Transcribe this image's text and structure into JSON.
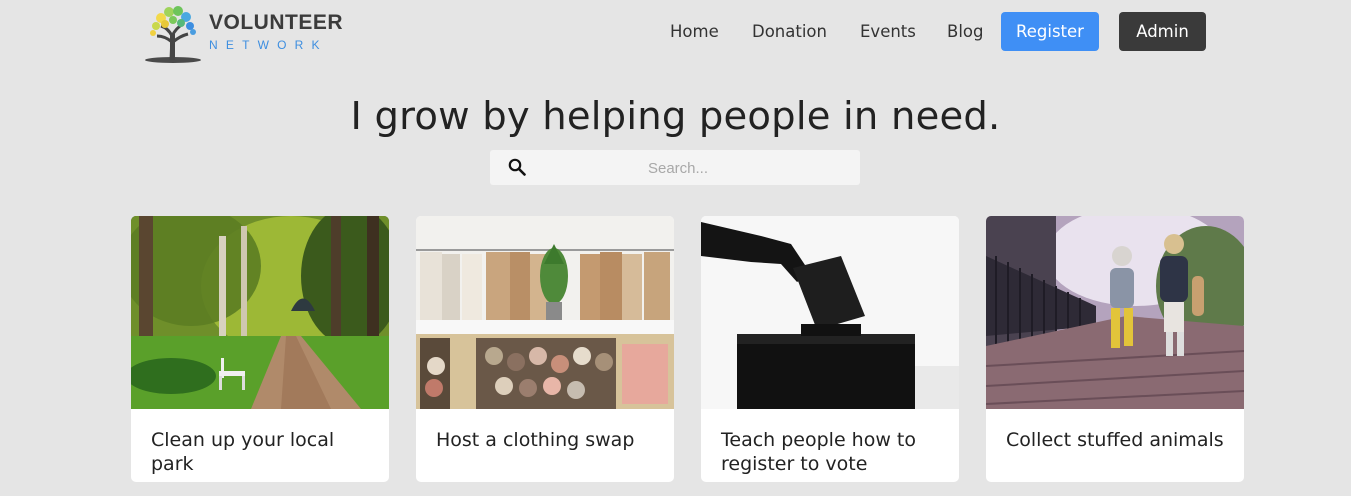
{
  "brand": {
    "name_top": "VOLUNTEER",
    "name_bottom": "NETWORK"
  },
  "nav": {
    "links": [
      "Home",
      "Donation",
      "Events",
      "Blog"
    ],
    "register_label": "Register",
    "admin_label": "Admin"
  },
  "hero": {
    "headline": "I grow by helping people in need."
  },
  "search": {
    "placeholder": "Search..."
  },
  "cards": [
    {
      "title": "Clean up your local park"
    },
    {
      "title": "Host a clothing swap"
    },
    {
      "title": "Teach people how to register to vote"
    },
    {
      "title": "Collect stuffed animals"
    }
  ],
  "colors": {
    "background": "#e5e5e5",
    "register": "#3f8ff5",
    "admin": "#3a3a3a",
    "brand_blue": "#3d8ee0"
  }
}
